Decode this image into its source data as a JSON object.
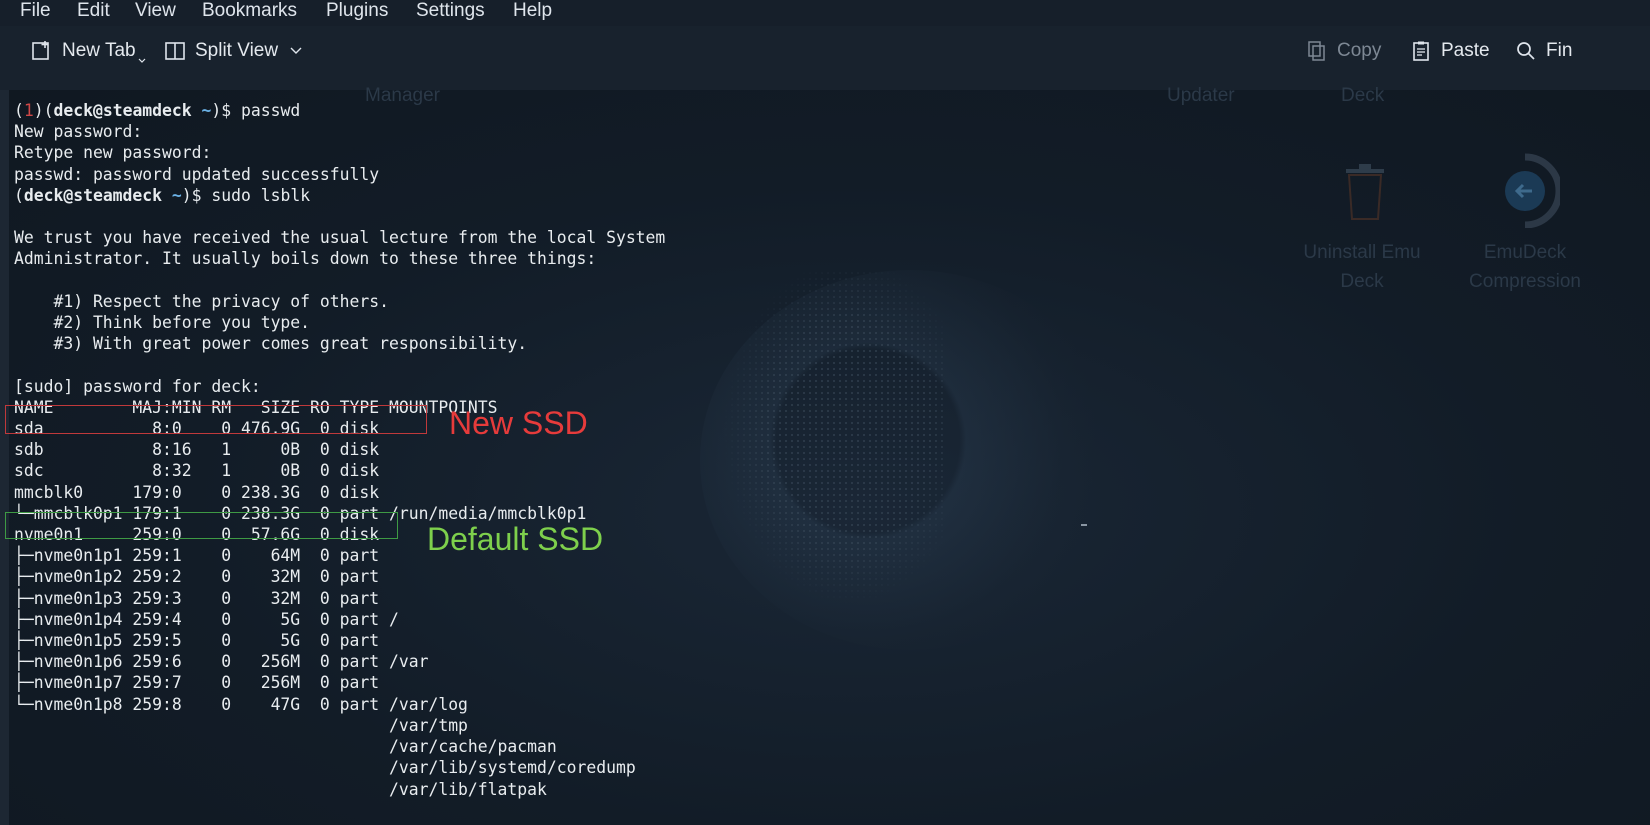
{
  "menubar": {
    "items": [
      "File",
      "Edit",
      "View",
      "Bookmarks",
      "Plugins",
      "Settings",
      "Help"
    ]
  },
  "toolbar": {
    "new_tab": "New Tab",
    "split_view": "Split View",
    "copy": "Copy",
    "paste": "Paste",
    "find": "Fin"
  },
  "background_desktop": {
    "manager_label": "Manager",
    "updater_label": "Updater",
    "deck_label": "Deck",
    "uninstall_label_line1": "Uninstall Emu",
    "uninstall_label_line2": "Deck",
    "emudeck_label_line1": "EmuDeck",
    "emudeck_label_line2": "Compression"
  },
  "terminal": {
    "prompt1_code": "1",
    "prompt_user_host": "deck@steamdeck",
    "prompt_dir": "~",
    "cmd1": "passwd",
    "lines_after_cmd1": [
      "New password:",
      "Retype new password:",
      "passwd: password updated successfully"
    ],
    "cmd2": "sudo lsblk",
    "lecture": [
      "",
      "We trust you have received the usual lecture from the local System",
      "Administrator. It usually boils down to these three things:",
      "",
      "    #1) Respect the privacy of others.",
      "    #2) Think before you type.",
      "    #3) With great power comes great responsibility.",
      "",
      "[sudo] password for deck:"
    ],
    "lsblk_header": "NAME        MAJ:MIN RM   SIZE RO TYPE MOUNTPOINTS",
    "lsblk_rows": [
      "sda           8:0    0 476.9G  0 disk",
      "sdb           8:16   1     0B  0 disk",
      "sdc           8:32   1     0B  0 disk",
      "mmcblk0     179:0    0 238.3G  0 disk",
      "└─mmcblk0p1 179:1    0 238.3G  0 part /run/media/mmcblk0p1",
      "nvme0n1     259:0    0  57.6G  0 disk",
      "├─nvme0n1p1 259:1    0    64M  0 part",
      "├─nvme0n1p2 259:2    0    32M  0 part",
      "├─nvme0n1p3 259:3    0    32M  0 part",
      "├─nvme0n1p4 259:4    0     5G  0 part /",
      "├─nvme0n1p5 259:5    0     5G  0 part",
      "├─nvme0n1p6 259:6    0   256M  0 part /var",
      "├─nvme0n1p7 259:7    0   256M  0 part",
      "└─nvme0n1p8 259:8    0    47G  0 part /var/log",
      "                                      /var/tmp",
      "                                      /var/cache/pacman",
      "                                      /var/lib/systemd/coredump",
      "                                      /var/lib/flatpak"
    ]
  },
  "annotations": {
    "new_ssd": "New SSD",
    "default_ssd": "Default SSD",
    "new_ssd_color": "#e63b3b",
    "default_ssd_color": "#7ed04c"
  }
}
